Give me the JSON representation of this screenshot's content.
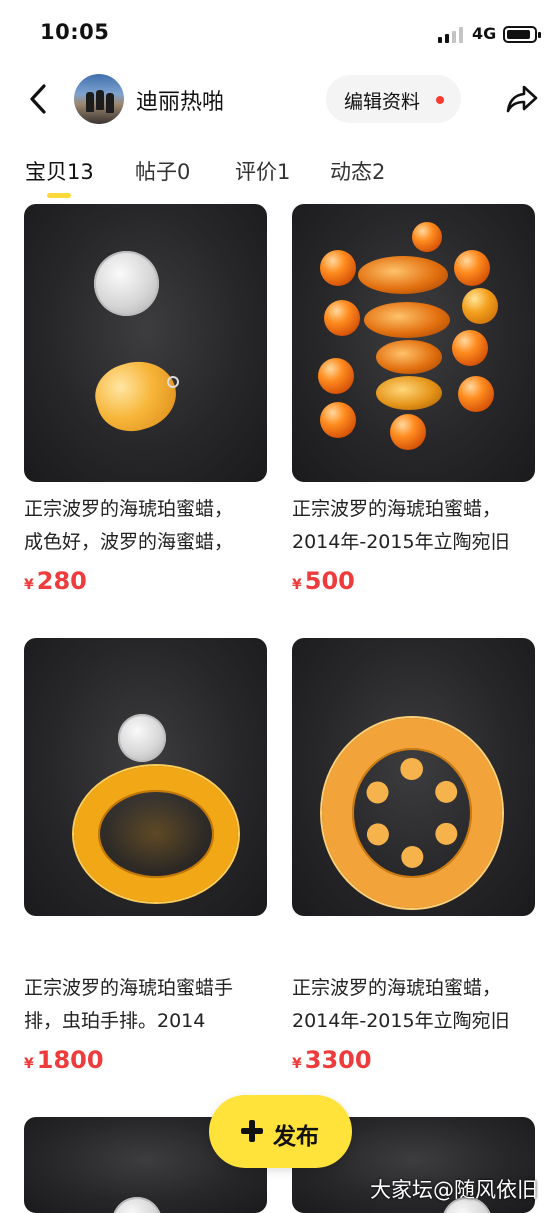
{
  "status_bar": {
    "time": "10:05",
    "network": "4G"
  },
  "header": {
    "nickname": "迪丽热啪",
    "edit_label": "编辑资料",
    "accent_color": "#ffe23a",
    "dot_color": "#ff3b30"
  },
  "tabs": [
    {
      "label": "宝贝",
      "count": "13"
    },
    {
      "label": "帖子",
      "count": "0"
    },
    {
      "label": "评价",
      "count": "1"
    },
    {
      "label": "动态",
      "count": "2"
    }
  ],
  "items": [
    {
      "title_line1": "正宗波罗的海琥珀蜜蜡，",
      "title_line2": "成色好，波罗的海蜜蜡，",
      "currency": "¥",
      "price": "280"
    },
    {
      "title_line1": "正宗波罗的海琥珀蜜蜡，",
      "title_line2": "2014年-2015年立陶宛旧",
      "currency": "¥",
      "price": "500"
    },
    {
      "title_line1": "正宗波罗的海琥珀蜜蜡手",
      "title_line2": "排，虫珀手排。2014",
      "currency": "¥",
      "price": "1800"
    },
    {
      "title_line1": "正宗波罗的海琥珀蜜蜡，",
      "title_line2": "2014年-2015年立陶宛旧",
      "currency": "¥",
      "price": "3300"
    }
  ],
  "fab": {
    "label": "发布"
  },
  "watermark": "大家坛@随风依旧",
  "price_color": "#ee3b3b"
}
